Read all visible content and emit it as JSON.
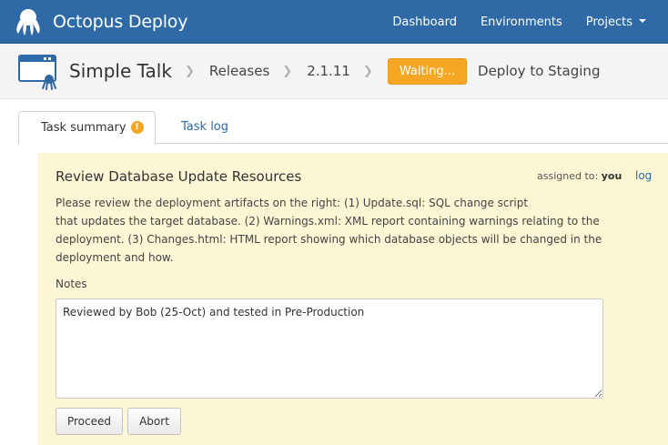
{
  "app": {
    "title": "Octopus Deploy"
  },
  "nav": {
    "items": [
      {
        "label": "Dashboard"
      },
      {
        "label": "Environments"
      },
      {
        "label": "Projects"
      }
    ]
  },
  "breadcrumb": {
    "project": "Simple Talk",
    "releases": "Releases",
    "version": "2.1.11",
    "status": "Waiting...",
    "action": "Deploy to Staging"
  },
  "tabs": [
    {
      "label": "Task summary",
      "badge": "!"
    },
    {
      "label": "Task log"
    }
  ],
  "task": {
    "title": "Review Database Update Resources",
    "assigned_prefix": "assigned to:",
    "assigned_to": "you",
    "log_link": "log",
    "instructions": [
      "Please review the deployment artifacts on the right: (1) Update.sql: SQL change script",
      "that updates the target database. (2) Warnings.xml: XML report containing warnings relating to the",
      "deployment. (3) Changes.html: HTML report showing which database objects will be changed in the",
      "deployment and how."
    ],
    "notes_label": "Notes",
    "notes_value": "Reviewed by Bob (25-Oct) and tested in Pre-Production",
    "proceed_label": "Proceed",
    "abort_label": "Abort"
  },
  "colors": {
    "navbar": "#2f6aa6",
    "waiting_badge": "#f5a623",
    "panel_background": "#fcf6d5",
    "link": "#2f6aa6"
  },
  "icons": {
    "brand": "octopus-logo-icon",
    "project": "project-window-octopus-icon",
    "breadcrumb_separator": "chevron-right-icon",
    "dropdown": "caret-down-icon",
    "tab_warning": "exclamation-badge-icon"
  }
}
